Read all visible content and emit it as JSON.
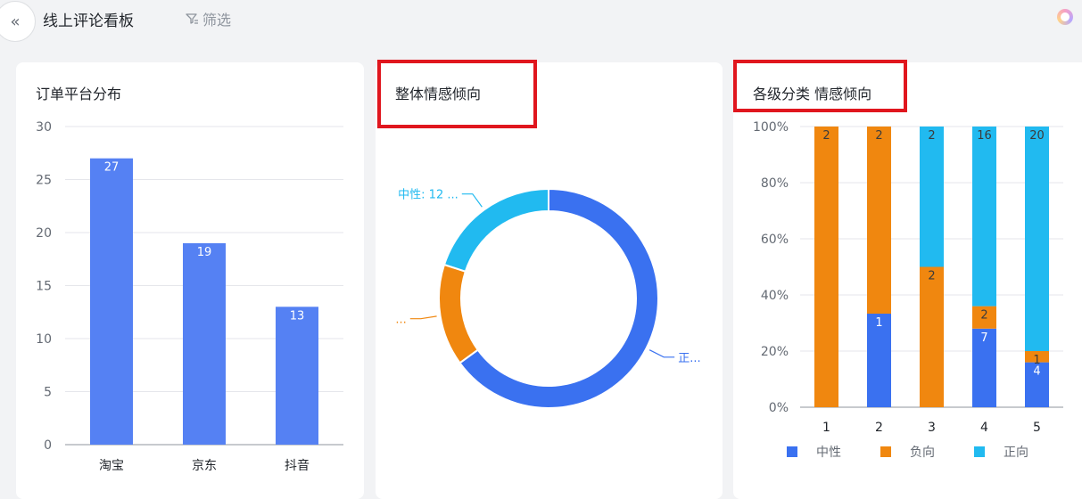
{
  "header": {
    "title": "线上评论看板",
    "filter_label": "筛选",
    "collapse_icon": "double-chevron-left-icon",
    "filter_icon": "filter-icon",
    "assistant_icon": "assistant-orb-icon"
  },
  "cards": {
    "platform": {
      "title": "订单平台分布"
    },
    "sentiment": {
      "title": "整体情感倾向"
    },
    "category": {
      "title": "各级分类 情感倾向"
    }
  },
  "colors": {
    "bar": "#5581f3",
    "neutral": "#3a71f0",
    "negative": "#f0870f",
    "positive": "#21baf0",
    "highlight": "#e0161e"
  },
  "chart_data": [
    {
      "type": "bar",
      "title": "订单平台分布",
      "categories": [
        "淘宝",
        "京东",
        "抖音"
      ],
      "values": [
        27,
        19,
        13
      ],
      "data_labels": [
        "27",
        "19",
        "13"
      ],
      "y_ticks": [
        "0",
        "5",
        "10",
        "15",
        "20",
        "25",
        "30"
      ],
      "ylim": [
        0,
        30
      ],
      "grid": true
    },
    {
      "type": "pie",
      "title": "整体情感倾向",
      "donut": true,
      "slices": [
        {
          "name": "正向",
          "value": 39,
          "label": "正...",
          "color": "#3a71f0"
        },
        {
          "name": "负向",
          "value": 9,
          "label": "...",
          "color": "#f0870f"
        },
        {
          "name": "中性",
          "value": 12,
          "label": "中性: 12 ...",
          "color": "#21baf0"
        }
      ]
    },
    {
      "type": "bar",
      "stacked": "percent",
      "title": "各级分类 情感倾向",
      "categories": [
        "1",
        "2",
        "3",
        "4",
        "5"
      ],
      "y_ticks": [
        "0%",
        "20%",
        "40%",
        "60%",
        "80%",
        "100%"
      ],
      "ylim": [
        0,
        100
      ],
      "legend_position": "bottom",
      "series": [
        {
          "name": "中性",
          "values": [
            0,
            1,
            0,
            7,
            4
          ],
          "labels": [
            "",
            "1",
            "",
            "7",
            "4"
          ],
          "color": "#3a71f0"
        },
        {
          "name": "负向",
          "values": [
            2,
            2,
            2,
            2,
            1
          ],
          "labels": [
            "2",
            "2",
            "2",
            "2",
            "1"
          ],
          "color": "#f0870f"
        },
        {
          "name": "正向",
          "values": [
            0,
            0,
            2,
            16,
            20
          ],
          "labels": [
            "",
            "",
            "2",
            "16",
            "20"
          ],
          "color": "#21baf0"
        }
      ]
    }
  ]
}
